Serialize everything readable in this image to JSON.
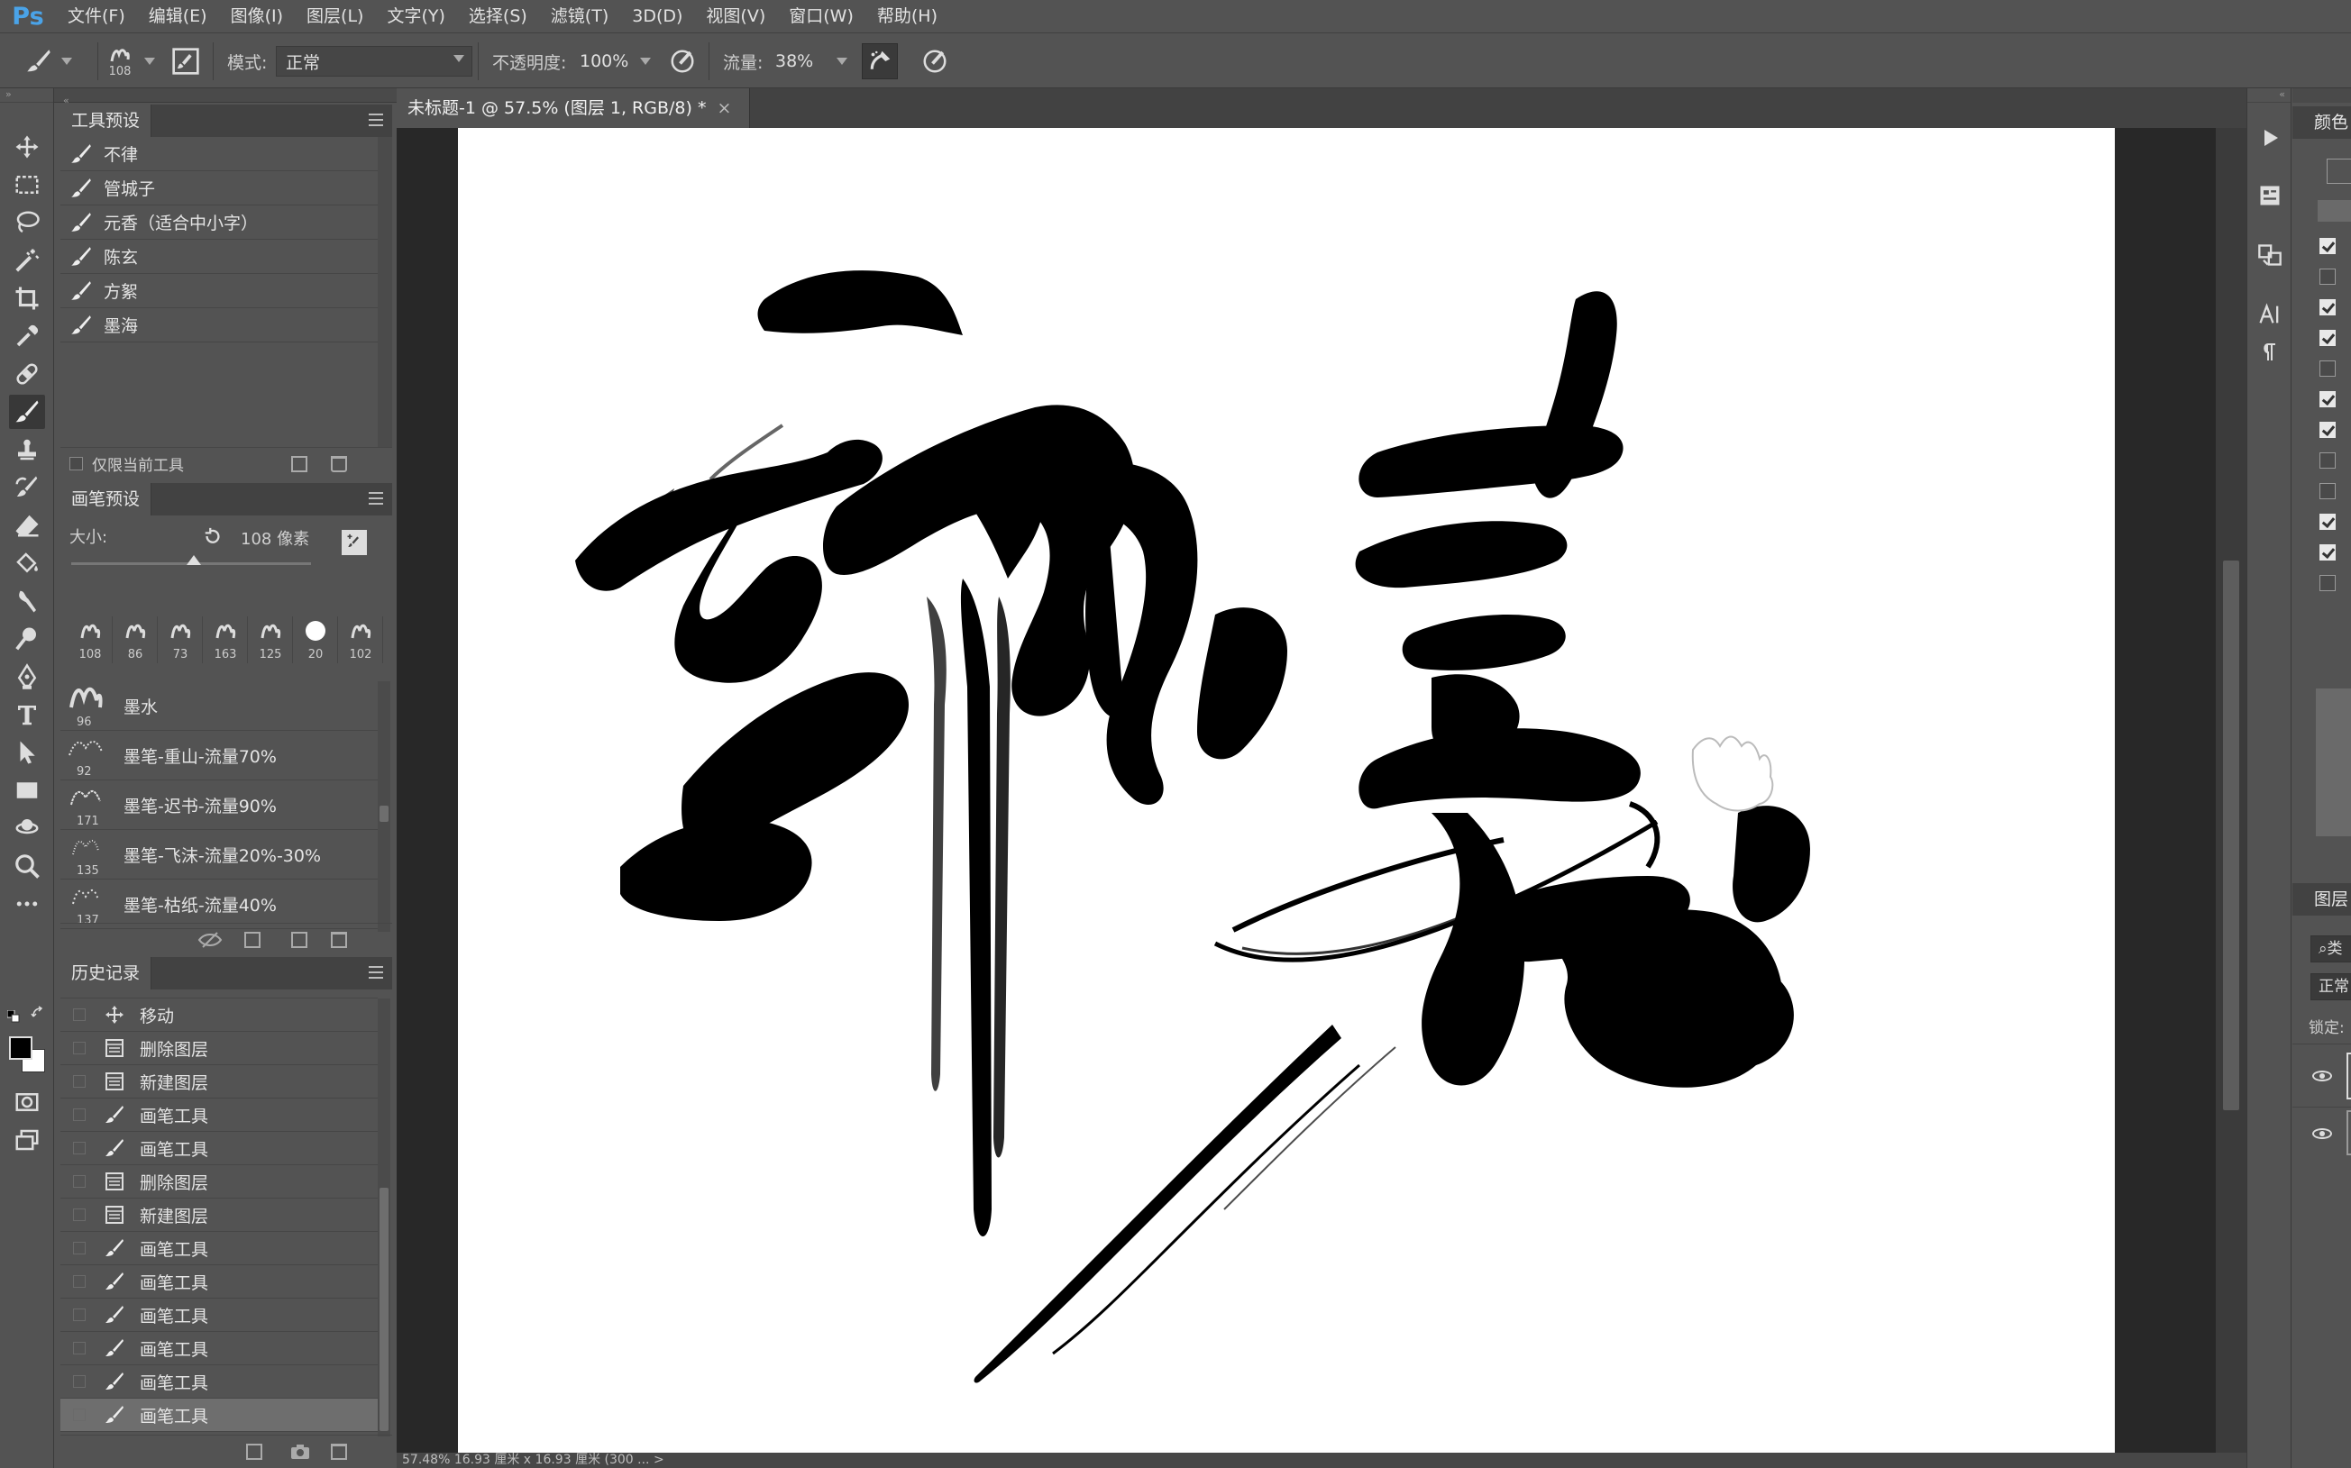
{
  "app": {
    "logo": "Ps",
    "menu": [
      "文件(F)",
      "编辑(E)",
      "图像(I)",
      "图层(L)",
      "文字(Y)",
      "选择(S)",
      "滤镜(T)",
      "3D(D)",
      "视图(V)",
      "窗口(W)",
      "帮助(H)"
    ]
  },
  "options": {
    "brush_size": "108",
    "mode_label": "模式:",
    "mode_value": "正常",
    "opacity_label": "不透明度:",
    "opacity_value": "100%",
    "flow_label": "流量:",
    "flow_value": "38%"
  },
  "tool_presets": {
    "tab": "工具预设",
    "items": [
      "不律",
      "管城子",
      "元香（适合中小字）",
      "陈玄",
      "方絮",
      "墨海"
    ],
    "footer_checkbox": "仅限当前工具"
  },
  "brush_presets": {
    "tab": "画笔预设",
    "size_label": "大小:",
    "size_value": "108 像素",
    "tips": [
      "108",
      "86",
      "73",
      "163",
      "125",
      "20",
      "102"
    ],
    "brushes": [
      {
        "num": "96",
        "name": "墨水"
      },
      {
        "num": "92",
        "name": "墨笔-重山-流量70%"
      },
      {
        "num": "171",
        "name": "墨笔-迟书-流量90%"
      },
      {
        "num": "135",
        "name": "墨笔-飞沫-流量20%-30%"
      },
      {
        "num": "137",
        "name": "墨笔-枯纸-流量40%"
      }
    ]
  },
  "history": {
    "tab": "历史记录",
    "items": [
      {
        "label": "移动",
        "icon": "move-icon"
      },
      {
        "label": "删除图层",
        "icon": "layer-icon"
      },
      {
        "label": "新建图层",
        "icon": "layer-icon"
      },
      {
        "label": "画笔工具",
        "icon": "brush-icon"
      },
      {
        "label": "画笔工具",
        "icon": "brush-icon"
      },
      {
        "label": "删除图层",
        "icon": "layer-icon"
      },
      {
        "label": "新建图层",
        "icon": "layer-icon"
      },
      {
        "label": "画笔工具",
        "icon": "brush-icon"
      },
      {
        "label": "画笔工具",
        "icon": "brush-icon"
      },
      {
        "label": "画笔工具",
        "icon": "brush-icon"
      },
      {
        "label": "画笔工具",
        "icon": "brush-icon"
      },
      {
        "label": "画笔工具",
        "icon": "brush-icon"
      },
      {
        "label": "画笔工具",
        "icon": "brush-icon"
      }
    ]
  },
  "document": {
    "tab_title": "未标题-1 @ 57.5% (图层 1, RGB/8) *",
    "close": "×",
    "status": "57.48%    16.93 厘米 x 16.93 厘米 (300 ...  >"
  },
  "right_panel": {
    "color_tab": "颜色",
    "layers_tab": "图层",
    "layers_mode": "正常",
    "lock_label": "锁定:",
    "search_prefix": "类",
    "checks": [
      true,
      false,
      true,
      true,
      false,
      true,
      true,
      false,
      false,
      true,
      true,
      false
    ]
  },
  "colors": {
    "ui_bg": "#535353",
    "panel_tab_bg": "#424242",
    "canvas_bg": "#282828",
    "accent_logo": "#4aa3e8",
    "ink": "#000000"
  }
}
